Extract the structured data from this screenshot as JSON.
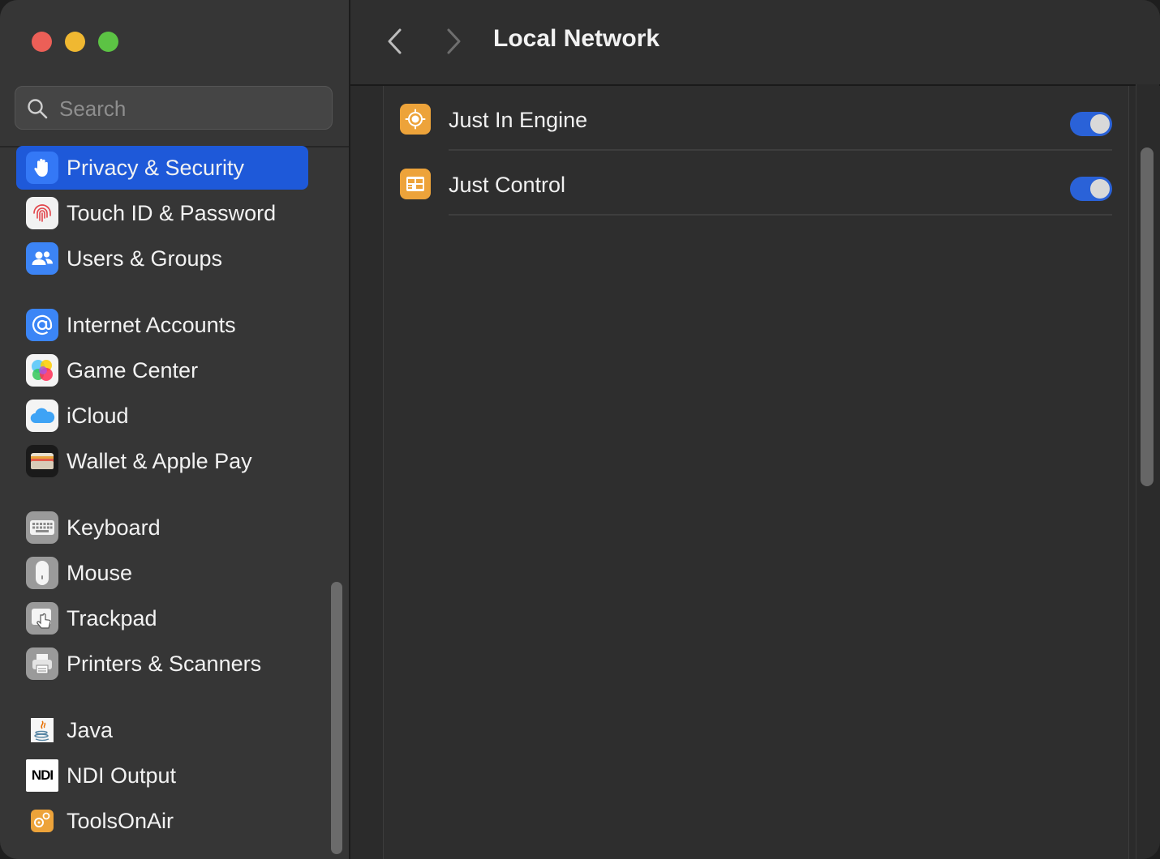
{
  "window": {
    "title": "Local Network",
    "traffic_lights": [
      "close",
      "minimize",
      "zoom"
    ]
  },
  "sidebar": {
    "search": {
      "placeholder": "Search",
      "value": ""
    },
    "items": [
      {
        "label": "Privacy & Security",
        "icon": "hand-icon",
        "selected": true
      },
      {
        "label": "Touch ID & Password",
        "icon": "fingerprint-icon"
      },
      {
        "label": "Users & Groups",
        "icon": "users-icon"
      },
      {
        "label": "Internet Accounts",
        "icon": "at-icon"
      },
      {
        "label": "Game Center",
        "icon": "game-center-icon"
      },
      {
        "label": "iCloud",
        "icon": "icloud-icon"
      },
      {
        "label": "Wallet & Apple Pay",
        "icon": "wallet-icon"
      },
      {
        "label": "Keyboard",
        "icon": "keyboard-icon"
      },
      {
        "label": "Mouse",
        "icon": "mouse-icon"
      },
      {
        "label": "Trackpad",
        "icon": "trackpad-icon"
      },
      {
        "label": "Printers & Scanners",
        "icon": "printer-icon"
      },
      {
        "label": "Java",
        "icon": "java-icon"
      },
      {
        "label": "NDI Output",
        "icon": "ndi-icon",
        "icon_text": "NDI"
      },
      {
        "label": "ToolsOnAir",
        "icon": "toolsonair-icon"
      }
    ]
  },
  "main": {
    "apps": [
      {
        "name": "Just In Engine",
        "icon": "just-in-engine-icon",
        "enabled": true
      },
      {
        "name": "Just Control",
        "icon": "just-control-icon",
        "enabled": true
      }
    ]
  },
  "colors": {
    "accent": "#1e59d9",
    "toggle_on": "#2a62d8",
    "app_icon": "#eda33a"
  }
}
